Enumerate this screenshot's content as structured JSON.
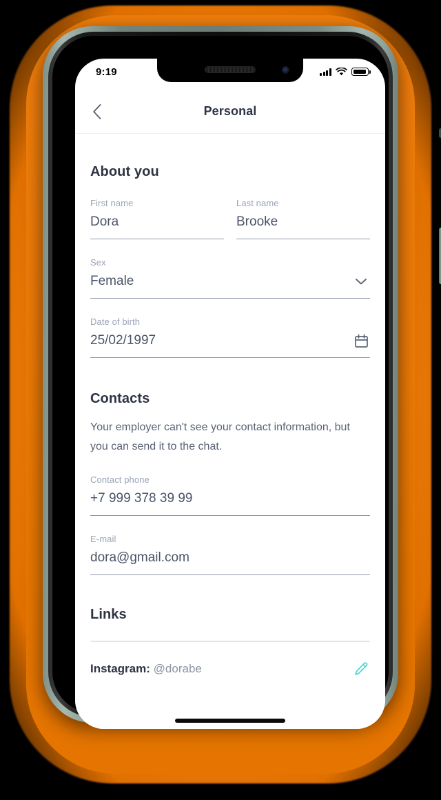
{
  "theme": {
    "backdrop_orange": "#EE7C08",
    "frame_metal": "#8FA39B",
    "screen_bg": "#FFFFFF",
    "heading_color": "#2E3444",
    "label_color": "#9AA4B5",
    "value_color": "#4A5568",
    "underline_color": "#8F97A8",
    "divider_color": "#E2E6EC",
    "accent_teal": "#3DD4CE"
  },
  "status_bar": {
    "time": "9:19",
    "signal_icon": "cellular-signal-icon",
    "wifi_icon": "wifi-icon",
    "battery_icon": "battery-full-icon"
  },
  "navbar": {
    "back_icon": "chevron-left-icon",
    "title": "Personal"
  },
  "sections": {
    "about": {
      "title": "About you",
      "fields": [
        {
          "label": "First name",
          "value": "Dora",
          "icon": null
        },
        {
          "label": "Last name",
          "value": "Brooke",
          "icon": null
        },
        {
          "label": "Sex",
          "value": "Female",
          "icon": "chevron-down-icon"
        },
        {
          "label": "Date of birth",
          "value": "25/02/1997",
          "icon": "calendar-icon"
        }
      ]
    },
    "contacts": {
      "title": "Contacts",
      "description": "Your employer can't see your contact information, but you can send it to the chat.",
      "fields": [
        {
          "label": "Contact phone",
          "value": "+7 999 378 39 99",
          "icon": null
        },
        {
          "label": "E-mail",
          "value": "dora@gmail.com",
          "icon": null
        }
      ]
    },
    "links": {
      "title": "Links",
      "items": [
        {
          "name": "Instagram:",
          "handle": "@dorabe",
          "edit_icon": "pencil-edit-icon"
        }
      ]
    }
  },
  "device": {
    "speaker_icon": "earpiece-speaker-icon",
    "camera_icon": "front-camera-icon",
    "home_indicator": "home-indicator-bar",
    "buttons": [
      "mute-switch",
      "volume-up-button",
      "volume-down-button",
      "power-button"
    ]
  }
}
